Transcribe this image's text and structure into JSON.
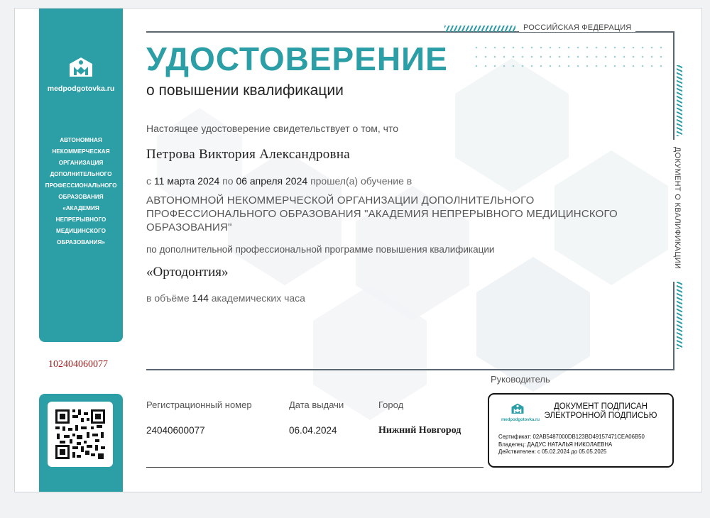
{
  "brand": {
    "site": "medpodgotovka.ru",
    "accent_color": "#2b9ea6",
    "serial_color": "#9b1b1b"
  },
  "sidebar": {
    "org_text": "АВТОНОМНАЯ\nНЕКОММЕРЧЕСКАЯ\nОРГАНИЗАЦИЯ\nДОПОЛНИТЕЛЬНОГО\nПРОФЕССИОНАЛЬНОГО\nОБРАЗОВАНИЯ\n«АКАДЕМИЯ\nНЕПРЕРЫВНОГО\nМЕДИЦИНСКОГО\nОБРАЗОВАНИЯ»",
    "serial_number": "102404060077",
    "qr_icon": "qr-code"
  },
  "header": {
    "country": "РОССИЙСКАЯ ФЕДЕРАЦИЯ",
    "title": "УДОСТОВЕРЕНИЕ",
    "subtitle": "о повышении квалификации",
    "side_label": "ДОКУМЕНТ О КВАЛИФИКАЦИИ"
  },
  "body": {
    "intro": "Настоящее удостоверение свидетельствует о том, что",
    "name": "Петрова Виктория Александровна",
    "from_word": "с",
    "date_from": "11 марта 2024",
    "to_word": "по",
    "date_to": "06 апреля 2024",
    "trained_text": "прошел(а) обучение в",
    "organization": "АВТОНОМНОЙ НЕКОММЕРЧЕСКОЙ ОРГАНИЗАЦИИ ДОПОЛНИТЕЛЬНОГО ПРОФЕССИОНАЛЬНОГО ОБРАЗОВАНИЯ \"АКАДЕМИЯ НЕПРЕРЫВНОГО МЕДИЦИНСКОГО ОБРАЗОВАНИЯ\"",
    "program_label": "по дополнительной профессиональной программе повышения квалификации",
    "program": "«Ортодонтия»",
    "volume_prefix": "в объёме",
    "hours": "144",
    "volume_suffix": "академических часа"
  },
  "footer": {
    "reg_label": "Регистрационный номер",
    "reg_value": "24040600077",
    "date_label": "Дата выдачи",
    "date_value": "06.04.2024",
    "city_label": "Город",
    "city_value": "Нижний Новгород",
    "head_label": "Руководитель"
  },
  "signature": {
    "title": "ДОКУМЕНТ ПОДПИСАН\nЭЛЕКТРОННОЙ ПОДПИСЬЮ",
    "certificate": "Сертификат: 02AB5487000DB123BD49157471CEA06B50",
    "owner": "Владелец: ДАДУС НАТАЛЬЯ НИКОЛАЕВНА",
    "valid": "Действителен: с 05.02.2024 до 05.05.2025",
    "logo_text": "medpodgotovka.ru"
  }
}
